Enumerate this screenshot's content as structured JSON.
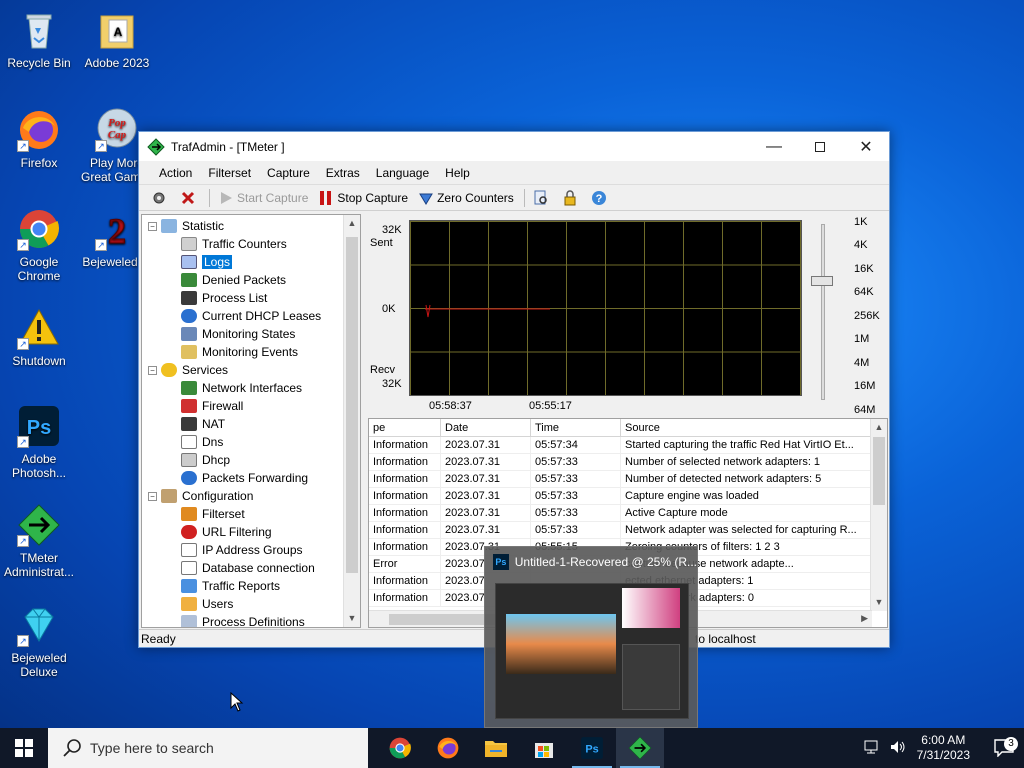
{
  "desktop": {
    "icons": [
      {
        "label": "Recycle Bin"
      },
      {
        "label": "Adobe 2023"
      },
      {
        "label": "Firefox"
      },
      {
        "label": "Play More Great Games"
      },
      {
        "label": "Google Chrome"
      },
      {
        "label": "Bejeweled"
      },
      {
        "label": "Shutdown"
      },
      {
        "label": "Adobe Photosh..."
      },
      {
        "label": "TMeter Administrat..."
      },
      {
        "label": "Bejeweled Deluxe"
      }
    ]
  },
  "window": {
    "title": "TrafAdmin - [TMeter ]",
    "menu": [
      "Action",
      "Filterset",
      "Capture",
      "Extras",
      "Language",
      "Help"
    ],
    "toolbar": {
      "start_capture": "Start Capture",
      "stop_capture": "Stop Capture",
      "zero_counters": "Zero Counters"
    },
    "tree": {
      "statistic": "Statistic",
      "statistic_children": [
        "Traffic Counters",
        "Logs",
        "Denied Packets",
        "Process List",
        "Current DHCP Leases",
        "Monitoring States",
        "Monitoring Events"
      ],
      "services": "Services",
      "services_children": [
        "Network Interfaces",
        "Firewall",
        "NAT",
        "Dns",
        "Dhcp",
        "Packets Forwarding"
      ],
      "configuration": "Configuration",
      "configuration_children": [
        "Filterset",
        "URL Filtering",
        "IP Address Groups",
        "Database connection",
        "Traffic Reports",
        "Users",
        "Process Definitions"
      ]
    },
    "graph": {
      "sent_label": "32K",
      "sent_text": "Sent",
      "zero_label": "0K",
      "recv_text": "Recv",
      "recv_label": "32K",
      "time_left": "05:58:37",
      "time_right": "05:55:17",
      "scale": [
        "1K",
        "4K",
        "16K",
        "64K",
        "256K",
        "1M",
        "4M",
        "16M",
        "64M"
      ]
    },
    "log": {
      "columns": [
        "pe",
        "Date",
        "Time",
        "Source"
      ],
      "rows": [
        [
          "Information",
          "2023.07.31",
          "05:57:34",
          "Started capturing the traffic Red Hat VirtIO Et..."
        ],
        [
          "Information",
          "2023.07.31",
          "05:57:33",
          "Number of selected network adapters: 1"
        ],
        [
          "Information",
          "2023.07.31",
          "05:57:33",
          "Number of detected network adapters: 5"
        ],
        [
          "Information",
          "2023.07.31",
          "05:57:33",
          "Capture engine was loaded"
        ],
        [
          "Information",
          "2023.07.31",
          "05:57:33",
          "Active Capture mode"
        ],
        [
          "Information",
          "2023.07.31",
          "05:57:33",
          "Network adapter was selected for capturing R..."
        ],
        [
          "Information",
          "2023.07.31",
          "05:55:15",
          "Zeroing counters of filters: 1 2 3"
        ],
        [
          "Error",
          "2023.07",
          "",
          "capture because network adapte..."
        ],
        [
          "Information",
          "2023.07",
          "",
          "ected ethernet adapters: 1"
        ],
        [
          "Information",
          "2023.07",
          "",
          "lected network adapters: 0"
        ]
      ]
    },
    "status": {
      "left": "Ready",
      "right": "to localhost"
    }
  },
  "ps_preview": {
    "title": "Untitled-1-Recovered @ 25% (R..."
  },
  "taskbar": {
    "search_placeholder": "Type here to search",
    "time": "6:00 AM",
    "date": "7/31/2023",
    "notification_count": "3"
  },
  "colors": {
    "accent": "#0078d7",
    "graph_grid": "#6f6b2a",
    "graph_line": "#c81414",
    "taskbar": "#101828"
  }
}
